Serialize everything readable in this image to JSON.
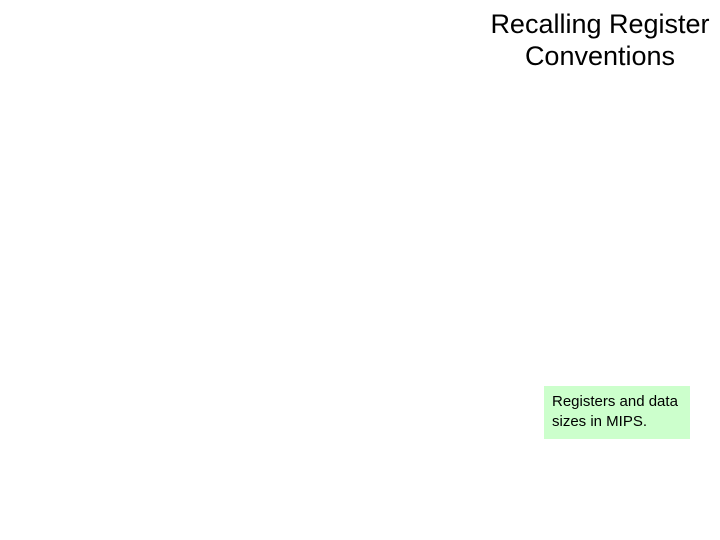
{
  "slide": {
    "title": "Recalling Register Conventions",
    "caption": "Registers and data sizes in MIPS."
  }
}
